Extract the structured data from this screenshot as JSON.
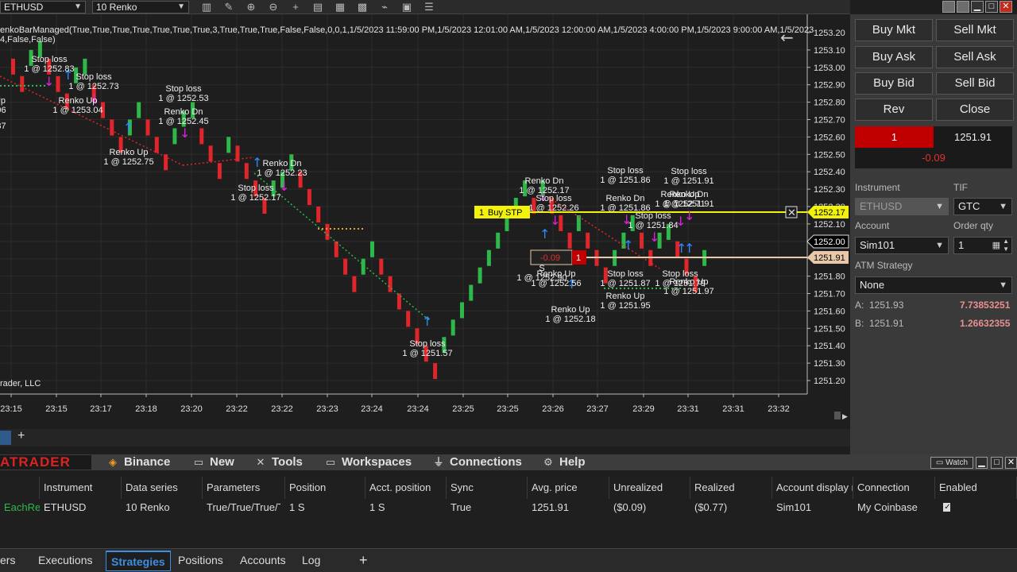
{
  "toolbar": {
    "instrument": "ETHUSD",
    "series": "10 Renko",
    "icons": [
      "bars-icon",
      "pencil-icon",
      "zoom-in-icon",
      "zoom-out-icon",
      "crosshair-icon",
      "properties-icon",
      "indicator-icon",
      "strategies-icon",
      "chart-trader-icon",
      "data-box-icon",
      "list-icon"
    ]
  },
  "chart": {
    "indicator_line1": "enkoBarManaged(True,True,True,True,True,True,True,3,True,True,True,False,False,0,0,1,1/5/2023 11:59:00 PM,1/5/2023 12:01:00 AM,1/5/2023 12:00:00 AM,1/5/2023 4:00:00 PM,1/5/2023 9:00:00 AM,1/5/2023",
    "indicator_line2": "4,False,False)",
    "copyright": "rader, LLC",
    "price_labels": [
      "1253.20",
      "1253.10",
      "1253.00",
      "1252.90",
      "1252.80",
      "1252.70",
      "1252.60",
      "1252.50",
      "1252.40",
      "1252.30",
      "1252.20",
      "1252.10",
      "1252.00",
      "1251.90",
      "1251.80",
      "1251.70",
      "1251.60",
      "1251.50",
      "1251.40",
      "1251.30",
      "1251.20"
    ],
    "time_labels": [
      "23:15",
      "23:15",
      "23:17",
      "23:18",
      "23:20",
      "23:22",
      "23:22",
      "23:23",
      "23:24",
      "23:24",
      "23:25",
      "23:25",
      "23:26",
      "23:27",
      "23:29",
      "23:31",
      "23:31",
      "23:32"
    ],
    "stop_label": "1252.17",
    "current_label": "1252.00",
    "position_label": "1251.91",
    "buy_stp_qty": "1",
    "buy_stp_text": "Buy STP",
    "pnl_text": "-0.09",
    "pnl_qty": "1",
    "annotations": [
      {
        "t1": "Stop loss",
        "t2": "1 @ 1252.83"
      },
      {
        "t1": "Stop loss",
        "t2": "1 @ 1252.73"
      },
      {
        "t1": "Up",
        "t2": ".96"
      },
      {
        "t1": "Renko Up",
        "t2": "1 @ 1253.04"
      },
      {
        "t1": ".87",
        "t2": ""
      },
      {
        "t1": "Stop loss",
        "t2": "1 @ 1252.53"
      },
      {
        "t1": "Renko Dn",
        "t2": "1 @ 1252.45"
      },
      {
        "t1": "Renko Up",
        "t2": "1 @ 1252.75"
      },
      {
        "t1": "Renko Dn",
        "t2": "1 @ 1252.23"
      },
      {
        "t1": "Stop loss",
        "t2": "1 @ 1252.17"
      },
      {
        "t1": "Stop loss",
        "t2": "1 @ 1251.57"
      },
      {
        "t1": "Renko Dn",
        "t2": "1 @ 1252.17"
      },
      {
        "t1": "Stop loss",
        "t2": "1 @ 1252.26"
      },
      {
        "t1": "Stop loss",
        "t2": "1 @ 1251.86"
      },
      {
        "t1": "Renko Dn",
        "t2": "1 @ 1251.86"
      },
      {
        "t1": "Stop loss",
        "t2": "1 @ 1251.91"
      },
      {
        "t1": "Renko Dn",
        "t2": "1 @ 1251.91"
      },
      {
        "t1": "Stop loss",
        "t2": "1 @ 1251.84"
      },
      {
        "t1": "Renko Up",
        "t2": "1 @ 1252.71"
      },
      {
        "t1": "Renko Up",
        "t2": "1 @ 1252.56"
      },
      {
        "t1": "Renko Up",
        "t2": "1 @ 1252.18"
      },
      {
        "t1": "Stop loss",
        "t2": "1 @ 1251.87"
      },
      {
        "t1": "Renko Up",
        "t2": "1 @ 1251.95"
      },
      {
        "t1": "Stop loss",
        "t2": "1 @ 1251.79"
      },
      {
        "t1": "Renko Up",
        "t2": "1 @ 1251.97"
      },
      {
        "t1": "S",
        "t2": "1 @ 1252.90"
      }
    ]
  },
  "panel": {
    "buy_mkt": "Buy Mkt",
    "sell_mkt": "Sell Mkt",
    "buy_ask": "Buy Ask",
    "sell_ask": "Sell Ask",
    "buy_bid": "Buy Bid",
    "sell_bid": "Sell Bid",
    "rev": "Rev",
    "close": "Close",
    "position_qty": "1",
    "position_price": "1251.91",
    "pnl": "-0.09",
    "instrument_label": "Instrument",
    "instrument_value": "ETHUSD",
    "tif_label": "TIF",
    "tif_value": "GTC",
    "account_label": "Account",
    "account_value": "Sim101",
    "orderqty_label": "Order qty",
    "orderqty_value": "1",
    "atm_label": "ATM Strategy",
    "atm_value": "None",
    "ask_label": "A:",
    "ask_price": "1251.93",
    "ask_size": "7.73853251",
    "bid_label": "B:",
    "bid_price": "1251.91",
    "bid_size": "1.26632355"
  },
  "menubar": {
    "brand": "ATRADER",
    "items": [
      {
        "label": "Binance",
        "icon": "binance-icon"
      },
      {
        "label": "New",
        "icon": "new-icon"
      },
      {
        "label": "Tools",
        "icon": "tools-icon"
      },
      {
        "label": "Workspaces",
        "icon": "workspaces-icon"
      },
      {
        "label": "Connections",
        "icon": "connections-icon"
      },
      {
        "label": "Help",
        "icon": "help-icon"
      }
    ],
    "watch": "Watch"
  },
  "grid": {
    "headers": [
      "Instrument",
      "Data series",
      "Parameters",
      "Position",
      "Acct. position",
      "Sync",
      "Avg. price",
      "Unrealized",
      "Realized",
      "Account display n",
      "Connection",
      "Enabled"
    ],
    "row": {
      "strategy": "EachRer",
      "instrument": "ETHUSD",
      "data_series": "10 Renko",
      "parameters": "True/True/True/T",
      "position": "1 S",
      "acct_position": "1 S",
      "sync": "True",
      "avg_price": "1251.91",
      "unrealized": "($0.09)",
      "realized": "($0.77)",
      "account": "Sim101",
      "connection": "My Coinbase"
    }
  },
  "bottomtabs": [
    "ers",
    "Executions",
    "Strategies",
    "Positions",
    "Accounts",
    "Log"
  ],
  "colors": {
    "up": "#2fb84a",
    "down": "#e0262b",
    "buy_stop": "#f2f20a",
    "position": "#e8c8a8",
    "brand": "#d22222",
    "active_tab": "#3d8fe0"
  }
}
